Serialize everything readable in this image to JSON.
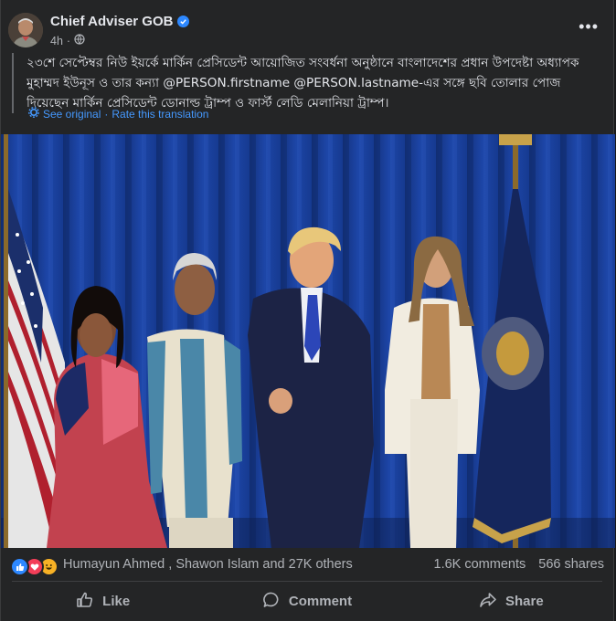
{
  "post": {
    "author": "Chief Adviser GOB",
    "time": "4h",
    "text": "২৩শে সেপ্টেম্বর নিউ ইয়র্কে মার্কিন প্রেসিডেন্ট আয়োজিত সংবর্ধনা অনুষ্ঠানে বাংলাদেশের প্রধান উপদেষ্টা অধ্যাপক মুহাম্মদ ইউনূস ও তার কন্যা @PERSON.firstname @PERSON.lastname-এর সঙ্গে ছবি তোলার পোজ দিয়েছেন মার্কিন প্রেসিডেন্ট ডোনাল্ড ট্রাম্প ও ফার্স্ট লেডি মেলানিয়া ট্রাম্প।",
    "see_original": "See original",
    "separator": "·",
    "rate_translation": "Rate this translation"
  },
  "reactions": {
    "icons": [
      "like-icon",
      "love-icon",
      "haha-icon"
    ],
    "names": "Humayun Ahmed , Shawon Islam and 27K others",
    "comments": "1.6K comments",
    "shares": "566 shares"
  },
  "actions": {
    "like": "Like",
    "comment": "Comment",
    "share": "Share"
  },
  "colors": {
    "background": "#242526",
    "text": "#e4e6eb",
    "secondary": "#b0b3b8",
    "link": "#4599ff",
    "verified": "#2d88ff"
  }
}
